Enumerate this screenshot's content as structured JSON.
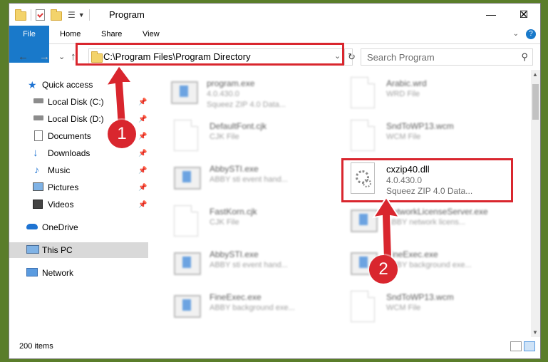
{
  "window": {
    "title": "Program",
    "minimize": "—",
    "maximize": "☐",
    "close": "✕"
  },
  "ribbon": {
    "tabs": [
      "File",
      "Home",
      "Share",
      "View"
    ],
    "help": "?"
  },
  "nav": {
    "back": "←",
    "forward": "→",
    "recent": "⌄",
    "up": "↑",
    "address": "C:\\Program Files\\Program Directory",
    "search_placeholder": "Search Program"
  },
  "sidebar": {
    "items": [
      {
        "label": "Quick access",
        "icon": "star-icon"
      },
      {
        "label": "Local Disk (C:)",
        "icon": "drive-icon",
        "pinned": true
      },
      {
        "label": "Local Disk (D:)",
        "icon": "drive-icon",
        "pinned": true
      },
      {
        "label": "Documents",
        "icon": "documents-icon",
        "pinned": true
      },
      {
        "label": "Downloads",
        "icon": "downloads-icon",
        "pinned": true
      },
      {
        "label": "Music",
        "icon": "music-icon",
        "pinned": true
      },
      {
        "label": "Pictures",
        "icon": "pictures-icon",
        "pinned": true
      },
      {
        "label": "Videos",
        "icon": "videos-icon",
        "pinned": true
      },
      {
        "label": "OneDrive",
        "icon": "cloud-icon"
      },
      {
        "label": "This PC",
        "icon": "computer-icon"
      },
      {
        "label": "Network",
        "icon": "network-icon"
      }
    ]
  },
  "files": {
    "left": [
      {
        "name": "program.exe",
        "line2": "4.0.430.0",
        "line3": "Squeez ZIP 4.0 Data..."
      },
      {
        "name": "DefaultFont.cjk",
        "line2": "CJK File",
        "line3": ""
      },
      {
        "name": "AbbySTI.exe",
        "line2": "ABBY sti event hand...",
        "line3": ""
      },
      {
        "name": "FastKorn.cjk",
        "line2": "CJK File",
        "line3": ""
      },
      {
        "name": "AbbySTI.exe",
        "line2": "ABBY sti event hand...",
        "line3": ""
      },
      {
        "name": "FineExec.exe",
        "line2": "ABBY background exe...",
        "line3": ""
      }
    ],
    "right": [
      {
        "name": "Arabic.wrd",
        "line2": "WRD File",
        "line3": ""
      },
      {
        "name": "SndToWP13.wcm",
        "line2": "WCM File",
        "line3": ""
      },
      {
        "name": "cxzip40.dll",
        "line2": "4.0.430.0",
        "line3": "Squeez ZIP 4.0 Data..."
      },
      {
        "name": "NetworkLicenseServer.exe",
        "line2": "ABBY network licens...",
        "line3": ""
      },
      {
        "name": "FineExec.exe",
        "line2": "ABBY background exe...",
        "line3": ""
      },
      {
        "name": "SndToWP13.wcm",
        "line2": "WCM File",
        "line3": ""
      }
    ]
  },
  "annotations": {
    "badge1": "1",
    "badge2": "2",
    "color": "#d9262e"
  },
  "status": {
    "item_count": "200 items"
  }
}
